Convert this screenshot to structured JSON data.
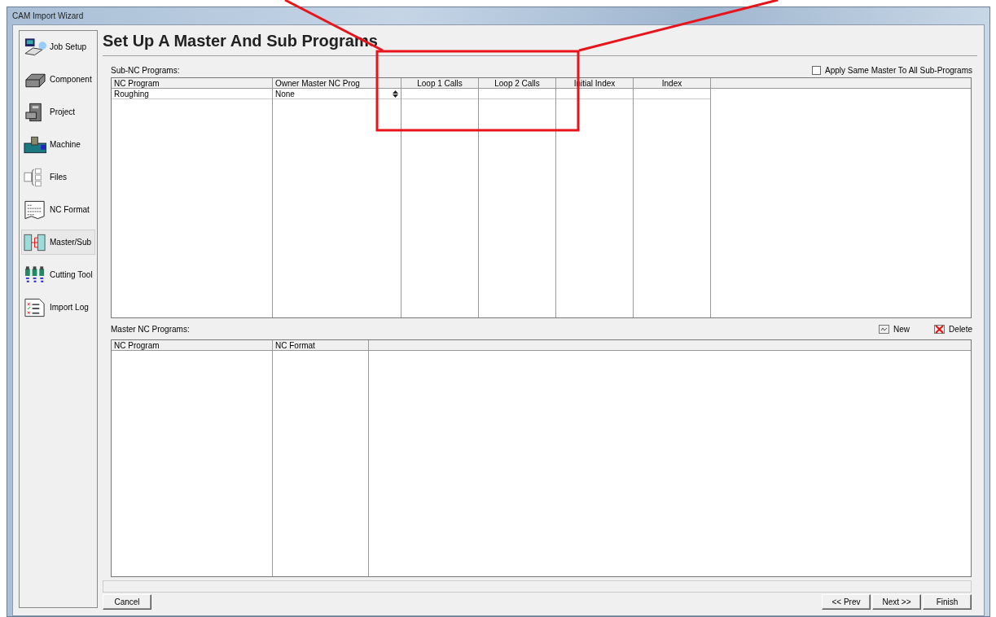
{
  "window": {
    "title": "CAM Import Wizard"
  },
  "sidebar": {
    "items": [
      {
        "label": "Job Setup",
        "selected": false
      },
      {
        "label": "Component",
        "selected": false
      },
      {
        "label": "Project",
        "selected": false
      },
      {
        "label": "Machine",
        "selected": false
      },
      {
        "label": "Files",
        "selected": false
      },
      {
        "label": "NC Format",
        "selected": false
      },
      {
        "label": "Master/Sub",
        "selected": true
      },
      {
        "label": "Cutting Tool",
        "selected": false
      },
      {
        "label": "Import Log",
        "selected": false
      }
    ]
  },
  "page_title": "Set Up A Master And Sub Programs",
  "sub_nc_programs": {
    "label": "Sub-NC Programs:",
    "apply_same_master": {
      "label": "Apply Same Master To All Sub-Programs",
      "checked": false
    },
    "columns": [
      "NC Program",
      "Owner Master NC Prog",
      "Loop 1 Calls",
      "Loop 2 Calls",
      "Initial Index",
      "Index"
    ],
    "rows": [
      {
        "nc_program": "Roughing",
        "owner_master": "None"
      }
    ]
  },
  "master_nc_programs": {
    "label": "Master NC Programs:",
    "actions": [
      "New",
      "Delete"
    ],
    "columns": [
      "NC Program",
      "NC Format"
    ]
  },
  "buttons": {
    "cancel": "Cancel",
    "prev": "<< Prev",
    "next": "Next >>",
    "finish": "Finish"
  }
}
